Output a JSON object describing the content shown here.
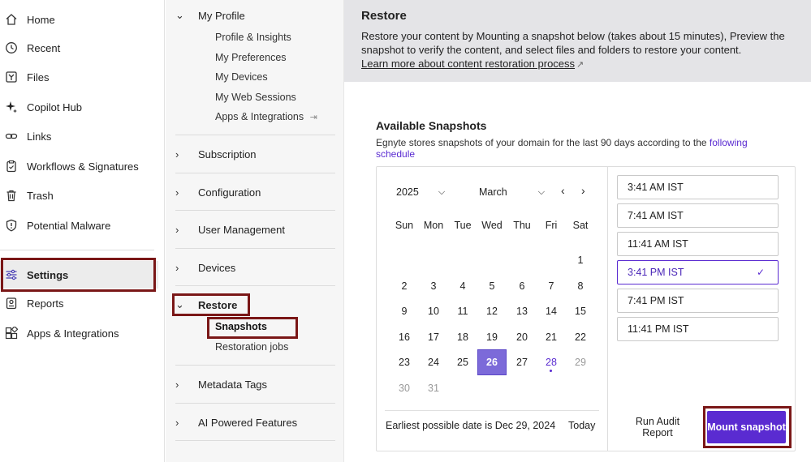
{
  "left_nav": {
    "items": [
      {
        "label": "Home",
        "icon": "home-icon"
      },
      {
        "label": "Recent",
        "icon": "clock-icon"
      },
      {
        "label": "Files",
        "icon": "files-icon"
      },
      {
        "label": "Copilot Hub",
        "icon": "sparkle-icon"
      },
      {
        "label": "Links",
        "icon": "link-icon"
      },
      {
        "label": "Workflows & Signatures",
        "icon": "clipboard-icon"
      },
      {
        "label": "Trash",
        "icon": "trash-icon"
      },
      {
        "label": "Potential Malware",
        "icon": "shield-icon"
      },
      {
        "label": "Settings",
        "icon": "sliders-icon"
      },
      {
        "label": "Reports",
        "icon": "reports-icon"
      },
      {
        "label": "Apps & Integrations",
        "icon": "apps-icon"
      }
    ]
  },
  "settings_nav": {
    "my_profile": "My Profile",
    "profile_items": [
      "Profile & Insights",
      "My Preferences",
      "My Devices",
      "My Web Sessions",
      "Apps & Integrations"
    ],
    "subscription": "Subscription",
    "configuration": "Configuration",
    "user_management": "User Management",
    "devices": "Devices",
    "restore": "Restore",
    "restore_items": [
      "Snapshots",
      "Restoration jobs"
    ],
    "metadata_tags": "Metadata Tags",
    "ai_features": "AI Powered Features"
  },
  "banner": {
    "title": "Restore",
    "description": "Restore your content by Mounting a snapshot below (takes about 15 minutes), Preview the snapshot to verify the content, and select files and folders to restore your content.",
    "link": "Learn more about content restoration process"
  },
  "snapshots": {
    "title": "Available Snapshots",
    "desc_prefix": "Egnyte stores snapshots of your domain for the last 90 days according to the",
    "desc_link": "following schedule"
  },
  "calendar": {
    "year": "2025",
    "month": "March",
    "weekdays": [
      "Sun",
      "Mon",
      "Tue",
      "Wed",
      "Thu",
      "Fri",
      "Sat"
    ],
    "selected_day": "26",
    "today_day": "28",
    "earliest_text": "Earliest possible date is Dec 29, 2024",
    "today_label": "Today"
  },
  "time_slots": [
    "3:41 AM IST",
    "7:41 AM IST",
    "11:41 AM IST",
    "3:41 PM IST",
    "7:41 PM IST",
    "11:41 PM IST"
  ],
  "selected_slot": "3:41 PM IST",
  "actions": {
    "audit": "Run Audit Report",
    "mount": "Mount snapshot"
  },
  "colors": {
    "accent": "#5a2bd1",
    "highlight_border": "#7a1717",
    "selected_day_bg": "#7c6ad9"
  }
}
